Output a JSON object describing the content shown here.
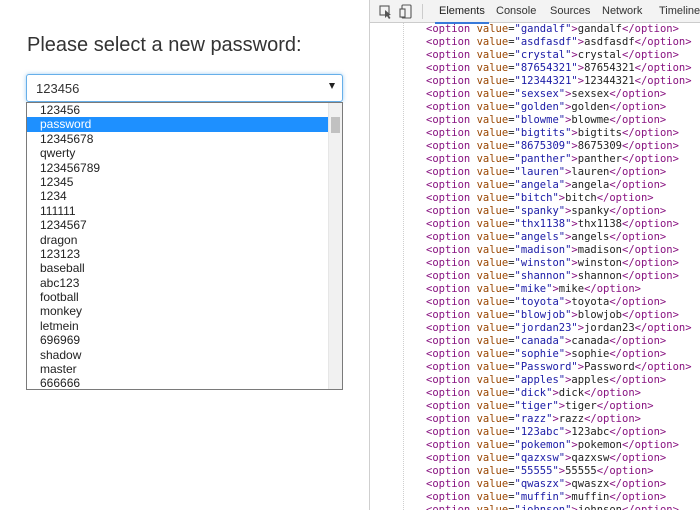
{
  "page": {
    "heading": "Please select a new password:",
    "select_value": "123456",
    "dropdown_selected_index": 1,
    "dropdown_options": [
      "123456",
      "password",
      "12345678",
      "qwerty",
      "123456789",
      "12345",
      "1234",
      "111111",
      "1234567",
      "dragon",
      "123123",
      "baseball",
      "abc123",
      "football",
      "monkey",
      "letmein",
      "696969",
      "shadow",
      "master",
      "666666"
    ]
  },
  "devtools": {
    "tabs": [
      "Elements",
      "Console",
      "Sources",
      "Network",
      "Timeline"
    ],
    "active_tab": "Elements",
    "colors": {
      "tag": "#881280",
      "attr": "#994500",
      "value": "#1a1aa6",
      "active_tab_underline": "#3879d9"
    },
    "code_lines": [
      {
        "value": "gandalf",
        "text": "gandalf"
      },
      {
        "value": "asdfasdf",
        "text": "asdfasdf"
      },
      {
        "value": "crystal",
        "text": "crystal"
      },
      {
        "value": "87654321",
        "text": "87654321"
      },
      {
        "value": "12344321",
        "text": "12344321"
      },
      {
        "value": "sexsex",
        "text": "sexsex"
      },
      {
        "value": "golden",
        "text": "golden"
      },
      {
        "value": "blowme",
        "text": "blowme"
      },
      {
        "value": "bigtits",
        "text": "bigtits"
      },
      {
        "value": "8675309",
        "text": "8675309"
      },
      {
        "value": "panther",
        "text": "panther"
      },
      {
        "value": "lauren",
        "text": "lauren"
      },
      {
        "value": "angela",
        "text": "angela"
      },
      {
        "value": "bitch",
        "text": "bitch"
      },
      {
        "value": "spanky",
        "text": "spanky"
      },
      {
        "value": "thx1138",
        "text": "thx1138"
      },
      {
        "value": "angels",
        "text": "angels"
      },
      {
        "value": "madison",
        "text": "madison"
      },
      {
        "value": "winston",
        "text": "winston"
      },
      {
        "value": "shannon",
        "text": "shannon"
      },
      {
        "value": "mike",
        "text": "mike"
      },
      {
        "value": "toyota",
        "text": "toyota"
      },
      {
        "value": "blowjob",
        "text": "blowjob"
      },
      {
        "value": "jordan23",
        "text": "jordan23"
      },
      {
        "value": "canada",
        "text": "canada"
      },
      {
        "value": "sophie",
        "text": "sophie"
      },
      {
        "value": "Password",
        "text": "Password"
      },
      {
        "value": "apples",
        "text": "apples"
      },
      {
        "value": "dick",
        "text": "dick"
      },
      {
        "value": "tiger",
        "text": "tiger"
      },
      {
        "value": "razz",
        "text": "razz"
      },
      {
        "value": "123abc",
        "text": "123abc"
      },
      {
        "value": "pokemon",
        "text": "pokemon"
      },
      {
        "value": "qazxsw",
        "text": "qazxsw"
      },
      {
        "value": "55555",
        "text": "55555"
      },
      {
        "value": "qwaszx",
        "text": "qwaszx"
      },
      {
        "value": "muffin",
        "text": "muffin"
      },
      {
        "value": "johnson",
        "text": "johnson"
      }
    ]
  }
}
